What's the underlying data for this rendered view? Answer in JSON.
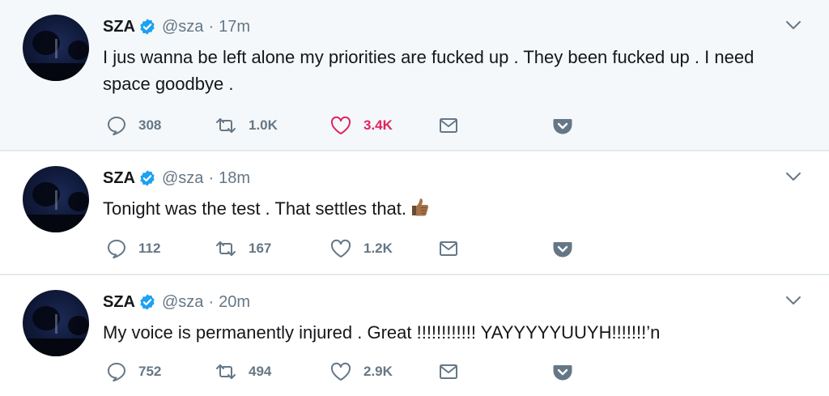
{
  "colors": {
    "text": "#14171a",
    "secondary": "#657786",
    "verified": "#1da1f2",
    "like_active": "#e0245e",
    "highlight_bg": "#f5f8fa",
    "divider": "#e1e8ed"
  },
  "tweets": [
    {
      "name": "SZA",
      "handle": "@sza",
      "separator": "·",
      "time": "17m",
      "text": "I jus wanna be left alone my priorities are fucked up . They been fucked up . I need space goodbye .",
      "replies": "308",
      "retweets": "1.0K",
      "likes": "3.4K",
      "liked": true
    },
    {
      "name": "SZA",
      "handle": "@sza",
      "separator": "·",
      "time": "18m",
      "text": "Tonight was the test . That settles that.",
      "emoji": "thumbs-up-icon",
      "replies": "112",
      "retweets": "167",
      "likes": "1.2K",
      "liked": false
    },
    {
      "name": "SZA",
      "handle": "@sza",
      "separator": "·",
      "time": "20m",
      "text": "My voice is permanently injured . Great !!!!!!!!!!!! YAYYYYYUUYH!!!!!!!’n",
      "replies": "752",
      "retweets": "494",
      "likes": "2.9K",
      "liked": false
    }
  ]
}
